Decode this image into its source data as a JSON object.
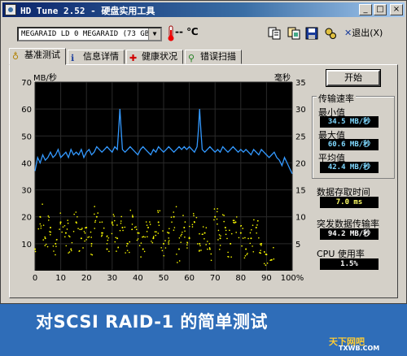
{
  "window": {
    "title": "HD Tune 2.52 - 硬盘实用工具",
    "buttons": {
      "minimize": "_",
      "maximize": "□",
      "close": "×"
    }
  },
  "toolbar": {
    "drive": "MEGARAID LD  0 MEGARAID (73 GB)",
    "temperature": "-- ℃",
    "exit_label": "退出(X)",
    "icons": [
      "copy-text-icon",
      "copy-image-icon",
      "save-icon",
      "options-icon",
      "exit-icon"
    ]
  },
  "tabs": [
    {
      "label": "基准测试",
      "icon": "benchmark-icon"
    },
    {
      "label": "信息详情",
      "icon": "info-icon"
    },
    {
      "label": "健康状况",
      "icon": "health-icon"
    },
    {
      "label": "错误扫描",
      "icon": "error-scan-icon"
    }
  ],
  "benchmark": {
    "start_label": "开始",
    "transfer_group_title": "传输速率",
    "min_label": "最小值",
    "min_value": "34.5 MB/秒",
    "max_label": "最大值",
    "max_value": "60.6 MB/秒",
    "avg_label": "平均值",
    "avg_value": "42.4 MB/秒",
    "access_label": "数据存取时间",
    "access_value": "7.0 ms",
    "burst_label": "突发数据传输率",
    "burst_value": "94.2 MB/秒",
    "cpu_label": "CPU 使用率",
    "cpu_value": "1.5%"
  },
  "banner": {
    "caption": "对SCSI RAID-1 的简单测试",
    "watermark_line1": "天下网吧",
    "watermark_line2": "TXWB.COM"
  },
  "chart_data": {
    "type": "line",
    "ylabel_left": "MB/秒",
    "ylabel_right": "毫秒",
    "x_ticks": [
      "0",
      "10",
      "20",
      "30",
      "40",
      "50",
      "60",
      "70",
      "80",
      "90",
      "100%"
    ],
    "y_left_ticks": [
      "10",
      "20",
      "30",
      "40",
      "50",
      "60",
      "70"
    ],
    "y_right_ticks": [
      "5",
      "10",
      "15",
      "20",
      "25",
      "30",
      "35"
    ],
    "xlim": [
      0,
      100
    ],
    "ylim_left": [
      0,
      70
    ],
    "ylim_right": [
      0,
      35
    ],
    "grid": true,
    "colors": {
      "background": "#000000",
      "transfer": "#3399ff",
      "access": "#ffff00",
      "grid": "#2a2a2a"
    },
    "series": [
      {
        "name": "transfer rate",
        "x": [
          0,
          1,
          2,
          3,
          4,
          5,
          6,
          7,
          8,
          9,
          10,
          11,
          12,
          13,
          14,
          15,
          16,
          17,
          18,
          19,
          20,
          21,
          22,
          23,
          24,
          25,
          26,
          27,
          28,
          29,
          30,
          31,
          32,
          32.5,
          33,
          33.5,
          34,
          35,
          36,
          37,
          38,
          39,
          40,
          41,
          42,
          43,
          44,
          45,
          46,
          47,
          48,
          49,
          50,
          51,
          52,
          53,
          54,
          55,
          56,
          57,
          58,
          59,
          60,
          61,
          62,
          63,
          63.5,
          64,
          64.5,
          65,
          66,
          67,
          68,
          69,
          70,
          71,
          72,
          73,
          74,
          75,
          76,
          77,
          78,
          79,
          80,
          81,
          82,
          83,
          84,
          85,
          86,
          87,
          88,
          89,
          90,
          91,
          92,
          93,
          94,
          95,
          96,
          97,
          98,
          99,
          100
        ],
        "values": [
          37,
          42,
          40,
          43,
          41,
          42,
          44,
          42,
          43,
          45,
          42,
          43,
          44,
          42,
          45,
          43,
          44,
          43,
          45,
          42,
          44,
          45,
          43,
          44,
          46,
          45,
          44,
          45,
          46,
          45,
          44,
          46,
          45,
          52,
          60,
          52,
          45,
          44,
          45,
          46,
          45,
          44,
          43,
          45,
          46,
          45,
          44,
          43,
          45,
          44,
          46,
          45,
          44,
          45,
          46,
          45,
          44,
          45,
          46,
          45,
          46,
          45,
          46,
          45,
          44,
          46,
          52,
          60,
          52,
          45,
          44,
          45,
          46,
          45,
          44,
          45,
          44,
          46,
          45,
          44,
          45,
          46,
          45,
          44,
          45,
          44,
          45,
          44,
          43,
          45,
          44,
          43,
          45,
          44,
          43,
          42,
          43,
          44,
          42,
          41,
          39,
          42,
          40,
          38,
          36
        ]
      },
      {
        "name": "access time",
        "x": [
          0,
          2,
          4,
          6,
          8,
          10,
          12,
          14,
          16,
          18,
          20,
          22,
          24,
          26,
          28,
          30,
          32,
          34,
          36,
          38,
          40,
          42,
          44,
          46,
          48,
          50,
          52,
          54,
          56,
          58,
          60,
          62,
          64,
          66,
          68,
          70,
          72,
          74,
          76,
          78,
          80,
          82,
          84,
          86,
          88,
          90,
          92
        ],
        "values": [
          4,
          10,
          6,
          8,
          5,
          9,
          7,
          4,
          9,
          6,
          8,
          5,
          10,
          7,
          4,
          9,
          6,
          8,
          5,
          10,
          7,
          4,
          8,
          6,
          9,
          5,
          7,
          10,
          4,
          8,
          6,
          9,
          5,
          7,
          4,
          10,
          6,
          8,
          5,
          9,
          7,
          4,
          6,
          8,
          5,
          3,
          2
        ]
      }
    ]
  }
}
